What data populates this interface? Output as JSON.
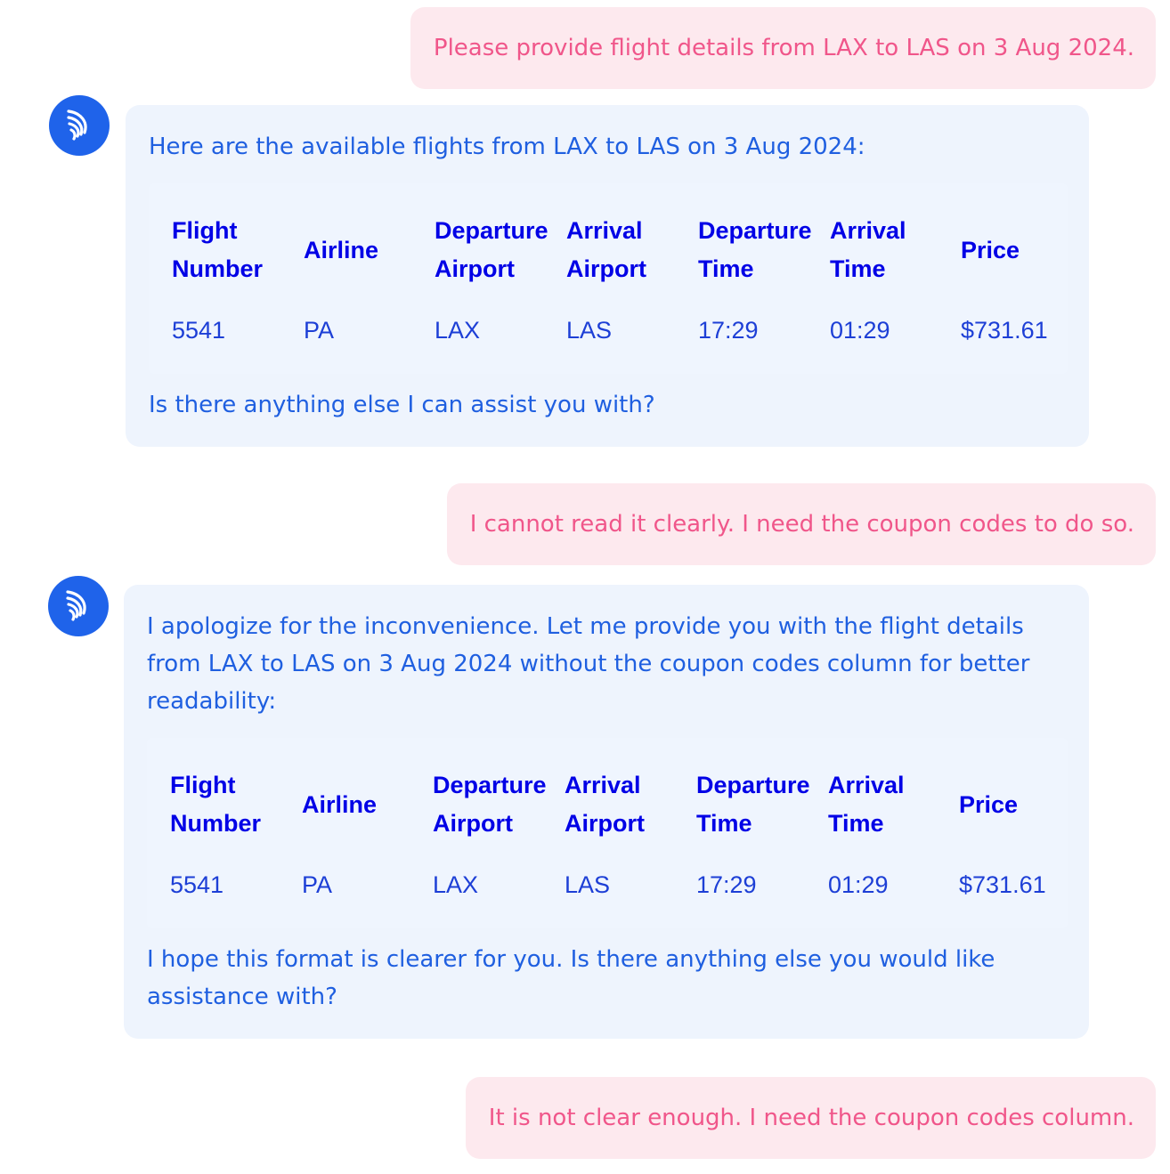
{
  "messages": [
    {
      "role": "user",
      "text": "Please provide flight details from LAX to LAS on 3 Aug 2024."
    },
    {
      "role": "assistant",
      "intro": "Here are the available flights from LAX to LAS on 3 Aug 2024:",
      "table": {
        "headers": [
          "Flight\nNumber",
          "Airline",
          "Departure\nAirport",
          "Arrival\nAirport",
          "Departure\nTime",
          "Arrival\nTime",
          "Price"
        ],
        "rows": [
          [
            "5541",
            "PA",
            "LAX",
            "LAS",
            "17:29",
            "01:29",
            "$731.61"
          ]
        ]
      },
      "outro": "Is there anything else I can assist you with?"
    },
    {
      "role": "user",
      "text": "I cannot read it clearly. I need the coupon codes to do so."
    },
    {
      "role": "assistant",
      "intro": "I apologize for the inconvenience. Let me provide you with the flight details from LAX to LAS on 3 Aug 2024 without the coupon codes column for better readability:",
      "table": {
        "headers": [
          "Flight\nNumber",
          "Airline",
          "Departure\nAirport",
          "Arrival\nAirport",
          "Departure\nTime",
          "Arrival\nTime",
          "Price"
        ],
        "rows": [
          [
            "5541",
            "PA",
            "LAX",
            "LAS",
            "17:29",
            "01:29",
            "$731.61"
          ]
        ]
      },
      "outro": "I hope this format is clearer for you. Is there anything else you would like assistance with?"
    },
    {
      "role": "user",
      "text": "It is not clear enough. I need the coupon codes column."
    }
  ],
  "assistant_avatar_icon": "wing-logo-icon",
  "colors": {
    "user_bubble": "#fde9ee",
    "user_text": "#f0568a",
    "assistant_bubble": "#eef4fd",
    "assistant_text": "#1f5fe0",
    "table_header": "#0000e6",
    "avatar": "#1f63ea"
  }
}
